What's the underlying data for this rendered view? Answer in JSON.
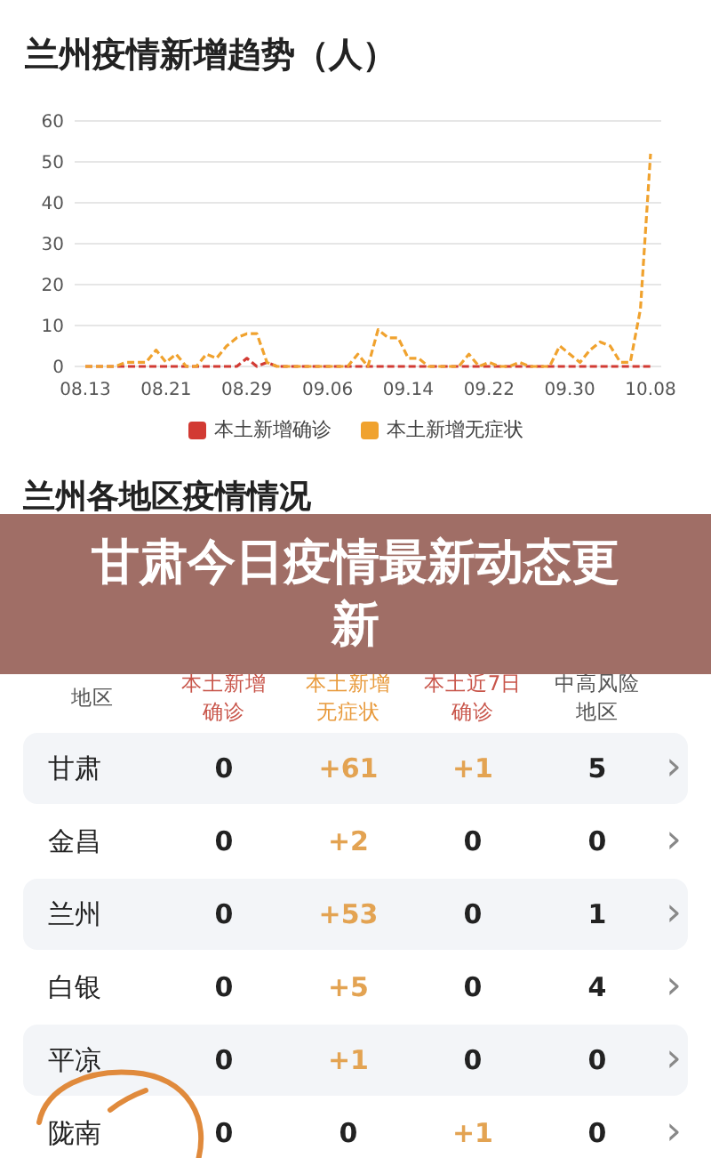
{
  "trend": {
    "title": "兰州疫情新增趋势（人）",
    "chart_data": {
      "type": "line",
      "categories": [
        "08.13",
        null,
        null,
        null,
        null,
        null,
        null,
        null,
        "08.21",
        null,
        null,
        null,
        null,
        null,
        null,
        null,
        "08.29",
        null,
        null,
        null,
        null,
        null,
        null,
        null,
        "09.06",
        null,
        null,
        null,
        null,
        null,
        null,
        null,
        "09.14",
        null,
        null,
        null,
        null,
        null,
        null,
        null,
        "09.22",
        null,
        null,
        null,
        null,
        null,
        null,
        null,
        "09.30",
        null,
        null,
        null,
        null,
        null,
        null,
        null,
        "10.08"
      ],
      "series": [
        {
          "name": "本土新增确诊",
          "color": "#d23a33",
          "line_style": "dashed",
          "values": [
            0,
            0,
            0,
            0,
            0,
            0,
            0,
            0,
            0,
            0,
            0,
            0,
            0,
            0,
            0,
            0,
            2,
            0,
            1,
            0,
            0,
            0,
            0,
            0,
            0,
            0,
            0,
            0,
            0,
            0,
            0,
            0,
            0,
            0,
            0,
            0,
            0,
            0,
            0,
            0,
            0,
            0,
            0,
            0,
            0,
            0,
            0,
            0,
            0,
            0,
            0,
            0,
            0,
            0,
            0,
            0,
            0
          ]
        },
        {
          "name": "本土新增无症状",
          "color": "#f0a22e",
          "line_style": "dashed",
          "values": [
            0,
            0,
            0,
            0,
            1,
            1,
            1,
            4,
            1,
            3,
            0,
            0,
            3,
            2,
            5,
            7,
            8,
            8,
            1,
            0,
            0,
            0,
            0,
            0,
            0,
            0,
            0,
            3,
            0,
            9,
            7,
            7,
            2,
            2,
            0,
            0,
            0,
            0,
            3,
            0,
            1,
            0,
            0,
            1,
            0,
            0,
            0,
            5,
            3,
            1,
            4,
            6,
            5,
            1,
            1,
            14,
            52
          ]
        }
      ],
      "yticks": [
        0,
        10,
        20,
        30,
        40,
        50,
        60
      ],
      "ylim": [
        0,
        60
      ],
      "grid": true
    }
  },
  "regions": {
    "title": "兰州各地区疫情情况",
    "columns": [
      {
        "label": "地区",
        "color": "#555555"
      },
      {
        "label": "本土新增确诊",
        "color": "#c8554a"
      },
      {
        "label": "本土新增无症状",
        "color": "#e89a3c"
      },
      {
        "label": "本土近7日确诊",
        "color": "#c8554a"
      },
      {
        "label": "中高风险地区",
        "color": "#555555"
      }
    ],
    "rows": [
      {
        "cells": [
          {
            "text": "甘肃"
          },
          {
            "text": "0",
            "highlight": false
          },
          {
            "text": "+61",
            "highlight": true
          },
          {
            "text": "+1",
            "highlight": true
          },
          {
            "text": "5",
            "highlight": false
          }
        ],
        "chevron": "›"
      },
      {
        "cells": [
          {
            "text": "金昌"
          },
          {
            "text": "0",
            "highlight": false
          },
          {
            "text": "+2",
            "highlight": true
          },
          {
            "text": "0",
            "highlight": false
          },
          {
            "text": "0",
            "highlight": false
          }
        ],
        "chevron": "›"
      },
      {
        "cells": [
          {
            "text": "兰州"
          },
          {
            "text": "0",
            "highlight": false
          },
          {
            "text": "+53",
            "highlight": true
          },
          {
            "text": "0",
            "highlight": false
          },
          {
            "text": "1",
            "highlight": false
          }
        ],
        "chevron": "›"
      },
      {
        "cells": [
          {
            "text": "白银"
          },
          {
            "text": "0",
            "highlight": false
          },
          {
            "text": "+5",
            "highlight": true
          },
          {
            "text": "0",
            "highlight": false
          },
          {
            "text": "4",
            "highlight": false
          }
        ],
        "chevron": "›"
      },
      {
        "cells": [
          {
            "text": "平凉"
          },
          {
            "text": "0",
            "highlight": false
          },
          {
            "text": "+1",
            "highlight": true
          },
          {
            "text": "0",
            "highlight": false
          },
          {
            "text": "0",
            "highlight": false
          }
        ],
        "chevron": "›"
      },
      {
        "cells": [
          {
            "text": "陇南"
          },
          {
            "text": "0",
            "highlight": false
          },
          {
            "text": "0",
            "highlight": false
          },
          {
            "text": "+1",
            "highlight": true
          },
          {
            "text": "0",
            "highlight": false
          }
        ],
        "chevron": "›"
      }
    ]
  },
  "banner": {
    "title": "甘肃今日疫情最新动态更新"
  }
}
